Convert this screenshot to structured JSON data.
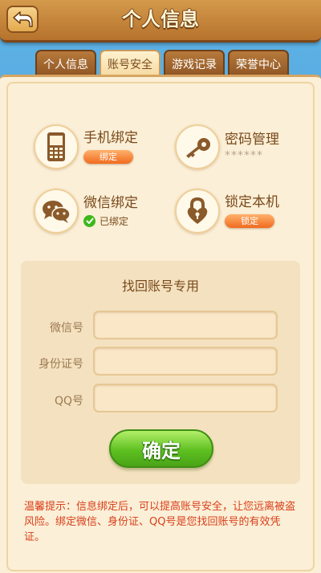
{
  "header": {
    "title": "个人信息",
    "back_icon": "back-arrow-icon"
  },
  "tabs": [
    {
      "label": "个人信息",
      "active": false
    },
    {
      "label": "账号安全",
      "active": true
    },
    {
      "label": "游戏记录",
      "active": false
    },
    {
      "label": "荣誉中心",
      "active": false
    }
  ],
  "features": {
    "phone": {
      "label": "手机绑定",
      "button": "绑定",
      "icon": "phone-icon"
    },
    "password": {
      "label": "密码管理",
      "masked": "******",
      "icon": "key-icon"
    },
    "wechat": {
      "label": "微信绑定",
      "status": "已绑定",
      "icon": "wechat-icon"
    },
    "lock": {
      "label": "锁定本机",
      "button": "锁定",
      "icon": "lock-icon"
    }
  },
  "recover": {
    "title": "找回账号专用",
    "fields": [
      {
        "label": "微信号",
        "value": ""
      },
      {
        "label": "身份证号",
        "value": ""
      },
      {
        "label": "QQ号",
        "value": ""
      }
    ],
    "confirm_label": "确定"
  },
  "hint": "温馨提示：信息绑定后，可以提高账号安全，让您远离被盗风险。绑定微信、身份证、QQ号是您找回账号的有效凭证。",
  "colors": {
    "accent": "#f06b1f",
    "confirm": "#5ec020",
    "hint": "#d9401b",
    "panel": "#fbefd7"
  }
}
